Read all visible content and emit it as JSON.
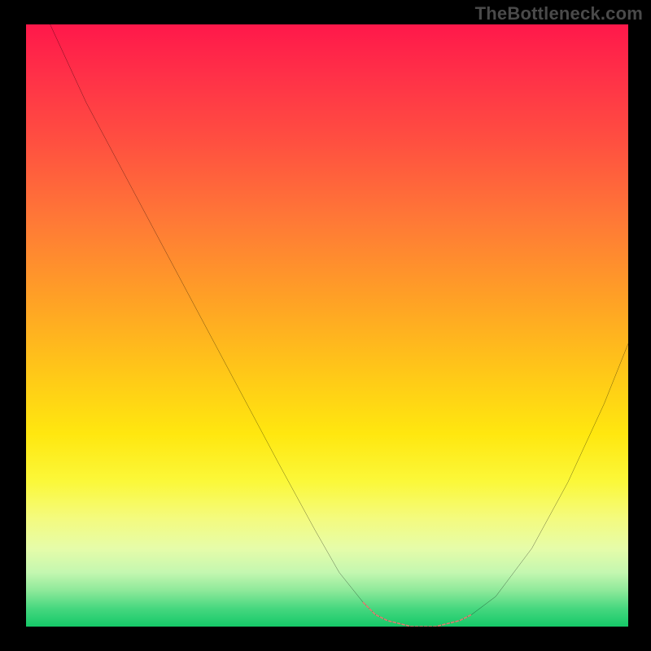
{
  "watermark": "TheBottleneck.com",
  "chart_data": {
    "type": "line",
    "title": "",
    "xlabel": "",
    "ylabel": "",
    "xlim": [
      0,
      100
    ],
    "ylim": [
      0,
      100
    ],
    "series": [
      {
        "name": "bottleneck-curve",
        "color": "#000000",
        "x": [
          4,
          10,
          18,
          26,
          34,
          42,
          48,
          52,
          56,
          58,
          60,
          64,
          68,
          72,
          74,
          78,
          84,
          90,
          96,
          100
        ],
        "values": [
          100,
          87,
          72,
          57,
          42,
          27,
          16,
          9,
          4,
          2,
          1,
          0,
          0,
          1,
          2,
          5,
          13,
          24,
          37,
          47
        ]
      }
    ],
    "markers": {
      "name": "highlight-segments",
      "color": "#e07a6f",
      "x": [
        56,
        58,
        60,
        64,
        68,
        72,
        74
      ],
      "values": [
        4,
        2,
        1,
        0,
        0,
        1,
        2
      ]
    },
    "gradient_stops": [
      {
        "pct": 0,
        "color": "#ff184a"
      },
      {
        "pct": 20,
        "color": "#ff5140"
      },
      {
        "pct": 46,
        "color": "#ffa225"
      },
      {
        "pct": 68,
        "color": "#ffe70f"
      },
      {
        "pct": 87,
        "color": "#e6fca9"
      },
      {
        "pct": 100,
        "color": "#15c968"
      }
    ]
  }
}
